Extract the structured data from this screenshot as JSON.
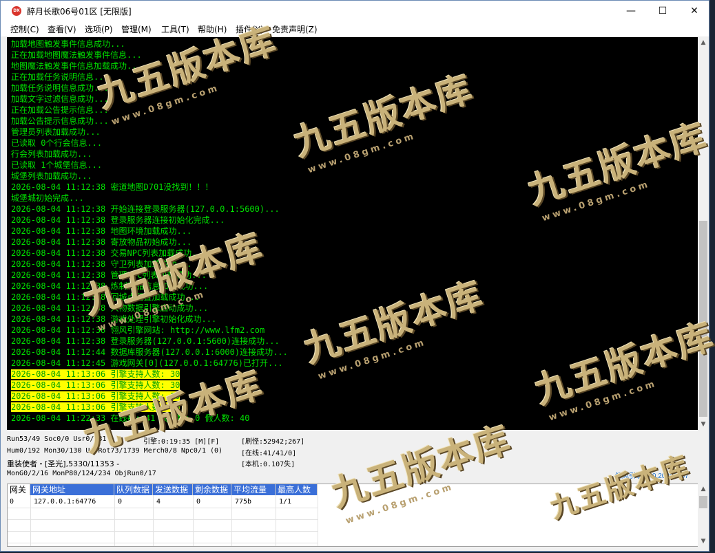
{
  "window": {
    "title": "醉月长歌06号01区 [无限版]",
    "icon_text": "DX"
  },
  "menu": [
    "控制(C)",
    "查看(V)",
    "选项(P)",
    "管理(M)",
    "工具(T)",
    "帮助(H)",
    "插件(Y)",
    "免责声明(Z)"
  ],
  "log_lines": [
    {
      "text": "加载地图触发事件信息成功...",
      "hl": false
    },
    {
      "text": "正在加载地图魔法触发事件信息...",
      "hl": false
    },
    {
      "text": "地图魔法触发事件信息加载成功...",
      "hl": false
    },
    {
      "text": "正在加载任务说明信息...",
      "hl": false
    },
    {
      "text": "加载任务说明信息成功...",
      "hl": false
    },
    {
      "text": "加载文字过滤信息成功...",
      "hl": false
    },
    {
      "text": "正在加载公告提示信息...",
      "hl": false
    },
    {
      "text": "加载公告提示信息成功...",
      "hl": false
    },
    {
      "text": "管理员列表加载成功...",
      "hl": false
    },
    {
      "text": "已读取 0个行会信息...",
      "hl": false
    },
    {
      "text": "行会列表加载成功...",
      "hl": false
    },
    {
      "text": "已读取 1个城堡信息...",
      "hl": false
    },
    {
      "text": "城堡列表加载成功...",
      "hl": false
    },
    {
      "text": "2026-08-04 11:12:38 密道地图D701没找到！！！",
      "hl": false
    },
    {
      "text": "城堡城初始完成...",
      "hl": false
    },
    {
      "text": "2026-08-04 11:12:38 开始连接登录服务器(127.0.0.1:5600)...",
      "hl": false
    },
    {
      "text": "2026-08-04 11:12:38 登录服务器连接初始化完成...",
      "hl": false
    },
    {
      "text": "2026-08-04 11:12:38 地图环境加载成功...",
      "hl": false
    },
    {
      "text": "2026-08-04 11:12:38 寄放物品初始成功...",
      "hl": false
    },
    {
      "text": "2026-08-04 11:12:38 交易NPC列表加载成功...",
      "hl": false
    },
    {
      "text": "2026-08-04 11:12:38 守卫列表加载成功...",
      "hl": false
    },
    {
      "text": "2026-08-04 11:12:38 管理NPC列表加载成功...",
      "hl": false
    },
    {
      "text": "2026-08-04 11:12:38 炼制物品信息加载成功...",
      "hl": false
    },
    {
      "text": "2026-08-04 11:12:38 回城点配置加载成功...",
      "hl": false
    },
    {
      "text": "2026-08-04 11:12:38 人物数据引擎启动成功...",
      "hl": false
    },
    {
      "text": "2026-08-04 11:12:38 游戏处理引擎初始化成功...",
      "hl": false
    },
    {
      "text": "2026-08-04 11:12:38 翎风引擎网站: http://www.lfm2.com",
      "hl": false
    },
    {
      "text": "2026-08-04 11:12:38 登录服务器(127.0.0.1:5600)连接成功...",
      "hl": false
    },
    {
      "text": "2026-08-04 11:12:44 数据库服务器(127.0.0.1:6000)连接成功...",
      "hl": false
    },
    {
      "text": "2026-08-04 11:12:45 游戏网关[0](127.0.0.1:64776)已打开...",
      "hl": false
    },
    {
      "text": "2026-08-04 11:13:06 引擎支持人数: 30",
      "hl": true
    },
    {
      "text": "2026-08-04 11:13:06 引擎支持人数: 30",
      "hl": true
    },
    {
      "text": "2026-08-04 11:13:06 引擎支持人数: 30",
      "hl": true
    },
    {
      "text": "2026-08-04 11:13:06 引擎支持人数: 30",
      "hl": true
    },
    {
      "text": "2026-08-04 11:22:33 在线数: 41 离线数: 0 假人数: 40",
      "hl": false
    }
  ],
  "status": {
    "row1_a": "Run53/49 Soc0/0 Usr0/131",
    "row1_b": "引擎:0:19:35 [M][F]",
    "row1_c": "[刷怪:52942;267]",
    "row2_a": "Hum0/192 Mon30/130 UsrRot73/1739 Merch0/8 Npc0/1 (0)",
    "row2_c": "[在线:41/41/0]",
    "row3_a": "重装使者・[圣光],5330/11353 -",
    "row3_c": "[本机:0.107失]",
    "row4_a": "MonG0/2/16 MonP80/124/234 ObjRun0/17",
    "version": "翎风引擎: 4.0.20260707"
  },
  "gate_table": {
    "columns": [
      "网关",
      "网关地址",
      "队列数据",
      "发送数据",
      "剩余数据",
      "平均流量",
      "最高人数"
    ],
    "rows": [
      [
        "0",
        "127.0.0.1:64776",
        "0",
        "4",
        "0",
        "775b",
        "1/1"
      ]
    ]
  },
  "watermark": {
    "main": "九五版本库",
    "sub": "www.08gm.com"
  }
}
